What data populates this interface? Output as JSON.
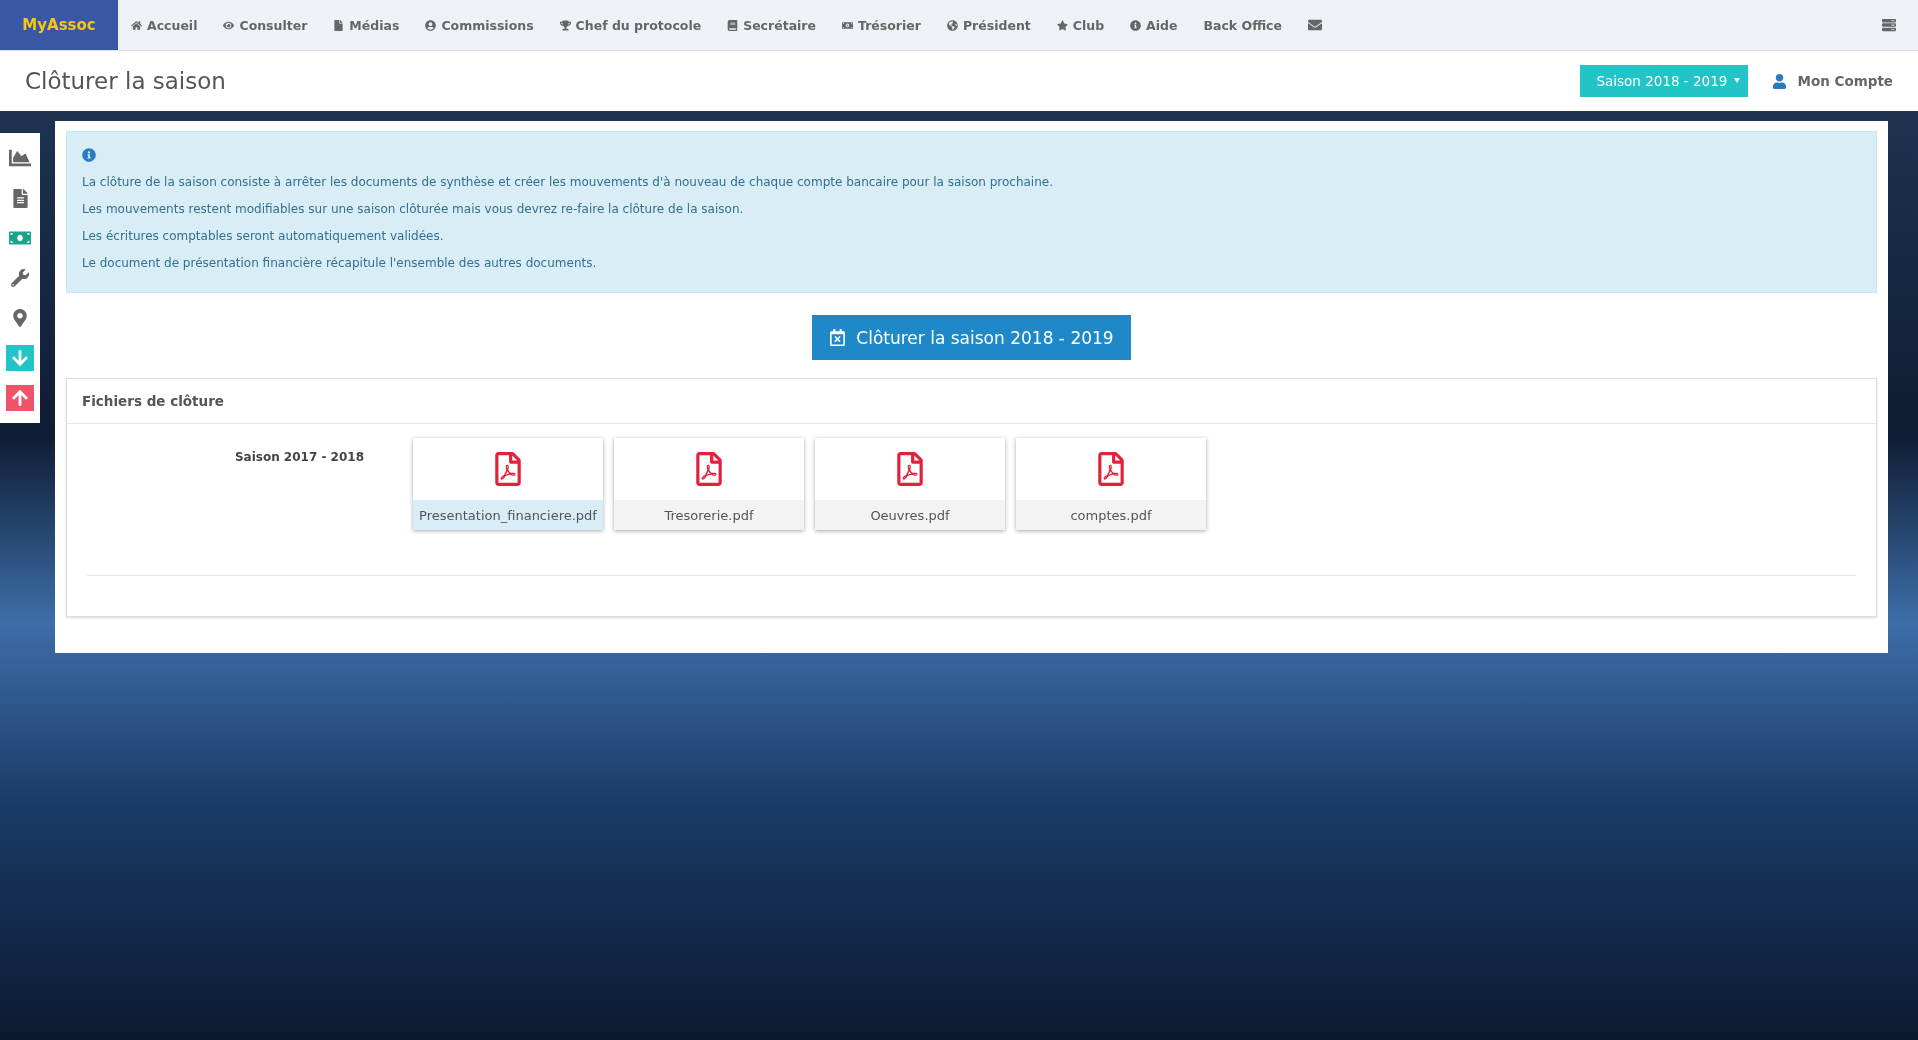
{
  "navbar": {
    "brand": "MyAssoc",
    "items": [
      "Accueil",
      "Consulter",
      "Médias",
      "Commissions",
      "Chef du protocole",
      "Secrétaire",
      "Trésorier",
      "Président",
      "Club",
      "Aide",
      "Back Office"
    ]
  },
  "header": {
    "title": "Clôturer la saison",
    "season_select": "Saison 2018 - 2019",
    "account": "Mon Compte"
  },
  "info": [
    "La clôture de la saison consiste à arrêter les documents de synthèse et créer les mouvements d'à nouveau de chaque compte bancaire pour la saison prochaine.",
    "Les mouvements restent modifiables sur une saison clôturée mais vous devrez re-faire la clôture de la saison.",
    "Les écritures comptables seront automatiquement validées.",
    "Le document de présentation financière récapitule l'ensemble des autres documents."
  ],
  "close_button": "Clôturer la saison 2018 - 2019",
  "files_panel": {
    "title": "Fichiers de clôture",
    "season": "Saison 2017 - 2018",
    "files": [
      {
        "name": "Presentation_financiere.pdf",
        "selected": true
      },
      {
        "name": "Tresorerie.pdf",
        "selected": false
      },
      {
        "name": "Oeuvres.pdf",
        "selected": false
      },
      {
        "name": "comptes.pdf",
        "selected": false
      }
    ]
  }
}
